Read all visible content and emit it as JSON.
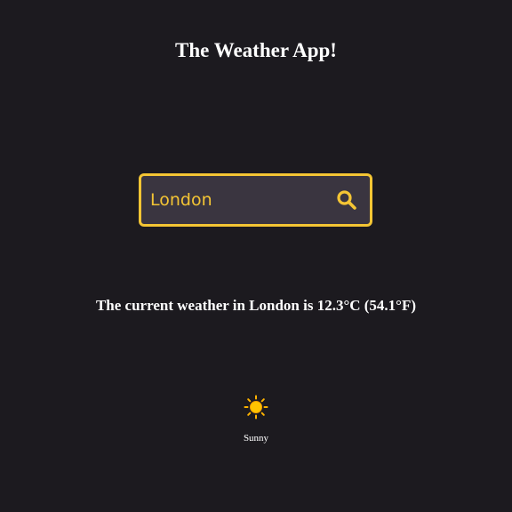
{
  "header": {
    "title": "The Weather App!"
  },
  "search": {
    "value": "London",
    "button_icon": "search-icon"
  },
  "colors": {
    "background": "#1c1a1f",
    "accent": "#f4c534",
    "input_bg": "#3a3540",
    "text": "#ffffff"
  },
  "weather": {
    "summary": "The current weather in London is 12.3°C (54.1°F)",
    "condition_icon": "sun-icon",
    "condition": "Sunny"
  }
}
